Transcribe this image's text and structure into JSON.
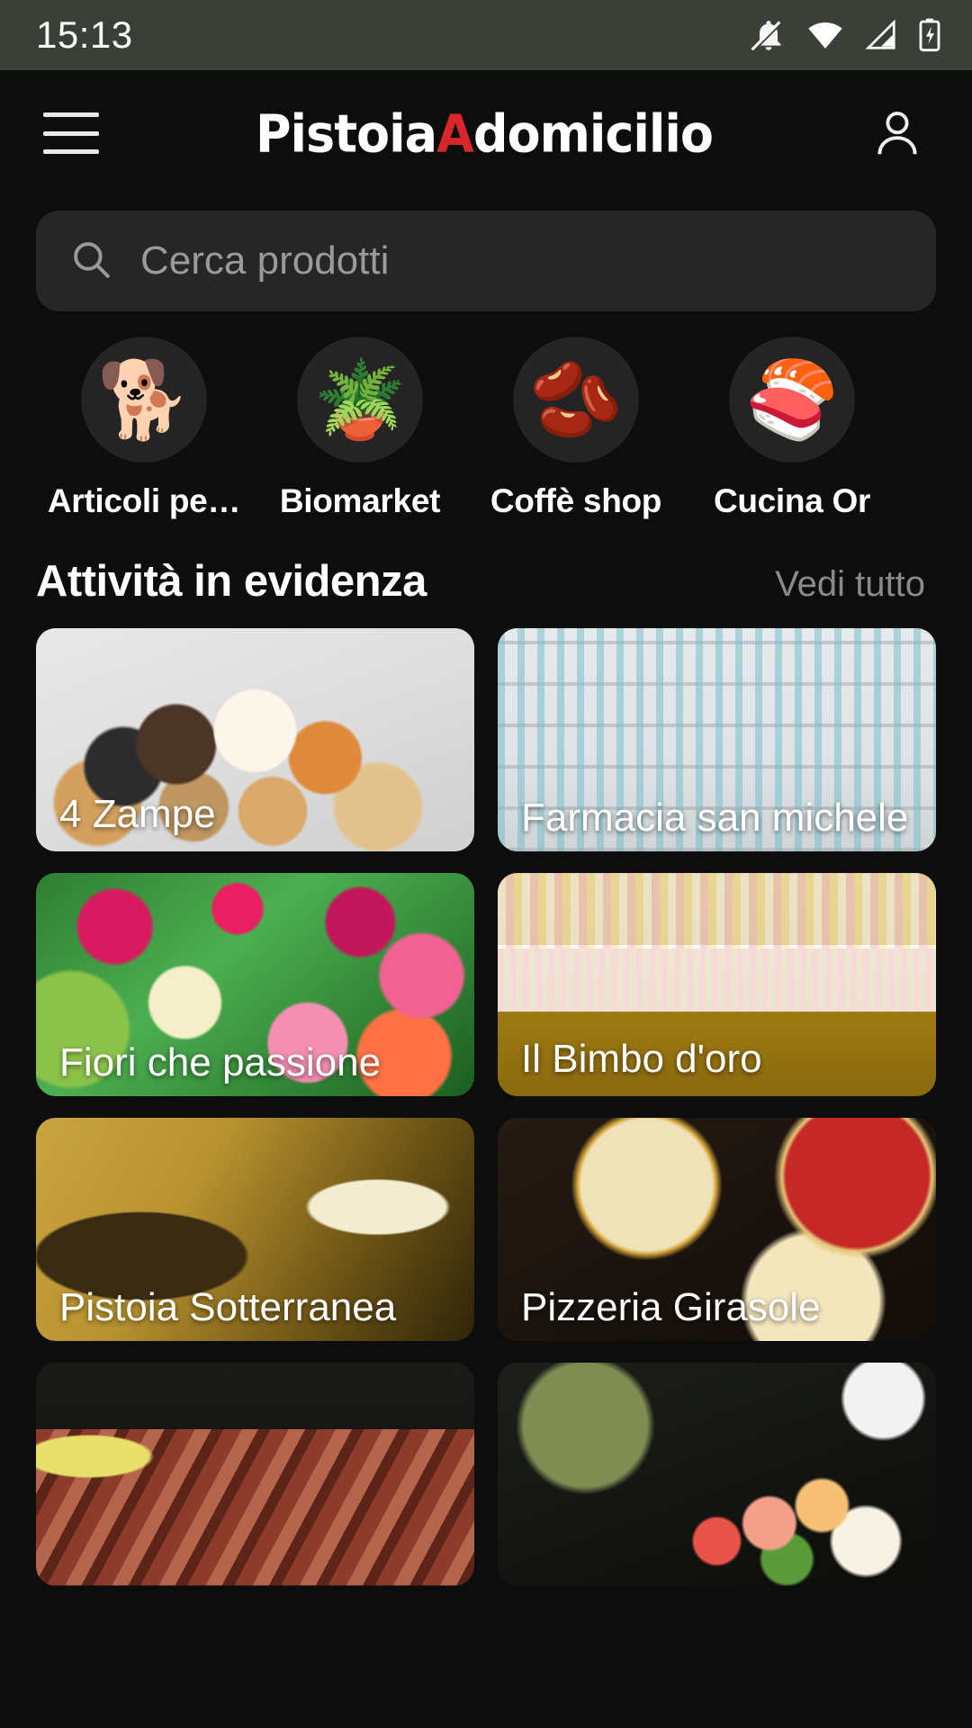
{
  "status_bar": {
    "time": "15:13",
    "icons": [
      "notifications-off-icon",
      "wifi-icon",
      "cellular-signal-icon",
      "battery-charging-icon"
    ]
  },
  "app_bar": {
    "menu_icon": "hamburger-menu-icon",
    "brand_part1": "Pistoia",
    "brand_accent": "A",
    "brand_part2": "domicilio",
    "account_icon": "account-person-icon",
    "accent_color": "#d6272b"
  },
  "search": {
    "icon": "search-icon",
    "placeholder": "Cerca prodotti",
    "value": ""
  },
  "categories": [
    {
      "label": "Articoli pe…",
      "icon": "dog-icon",
      "glyph": "🐕"
    },
    {
      "label": "Biomarket",
      "icon": "potted-plant-icon",
      "glyph": "🪴"
    },
    {
      "label": "Coffè shop",
      "icon": "coffee-bean-icon",
      "glyph": "🫘"
    },
    {
      "label": "Cucina Or",
      "icon": "sushi-icon",
      "glyph": "🍣"
    }
  ],
  "featured": {
    "title": "Attività in evidenza",
    "see_all": "Vedi tutto",
    "cards": [
      {
        "title": "4 Zampe",
        "image": "img-pets"
      },
      {
        "title": "Farmacia san michele",
        "image": "img-pharmacy"
      },
      {
        "title": "Fiori che passione",
        "image": "img-flowers"
      },
      {
        "title": "Il Bimbo d'oro",
        "image": "img-kids"
      },
      {
        "title": "Pistoia Sotterranea",
        "image": "img-cellar"
      },
      {
        "title": "Pizzeria Girasole",
        "image": "img-pizza"
      },
      {
        "title": "",
        "image": "img-meat"
      },
      {
        "title": "",
        "image": "img-sushi"
      }
    ]
  }
}
